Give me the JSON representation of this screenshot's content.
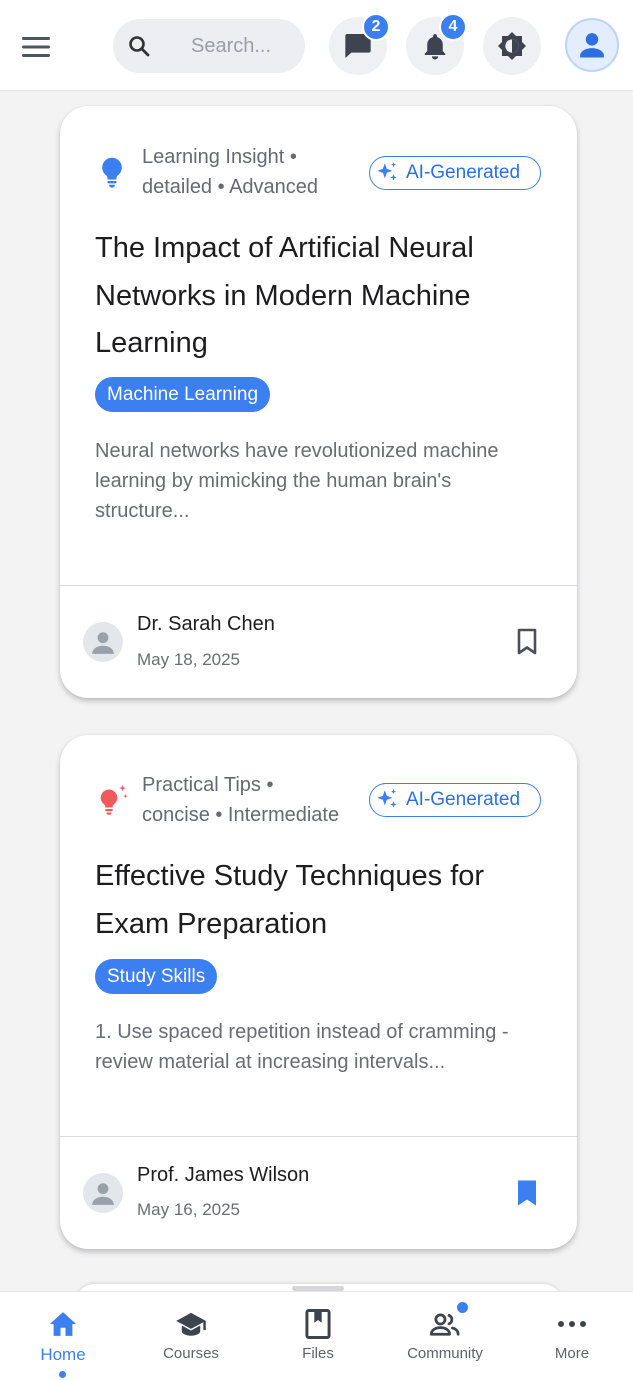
{
  "header": {
    "search_placeholder": "Search...",
    "messages_badge": "2",
    "notifications_badge": "4"
  },
  "posts": [
    {
      "meta_line1": "Learning Insight •",
      "meta_line2": "detailed • Advanced",
      "ai_label": "AI-Generated",
      "title": "The Impact of Artificial Neural Networks in Modern Machine Learning",
      "tag": "Machine Learning",
      "excerpt": "Neural networks have revolutionized machine learning by mimicking the human brain's structure...",
      "author": "Dr. Sarah Chen",
      "date": "May 18, 2025",
      "icon": "lightbulb-icon",
      "icon_color": "#3b7ff0",
      "bookmarked": false
    },
    {
      "meta_line1": "Practical Tips •",
      "meta_line2": "concise • Intermediate",
      "ai_label": "AI-Generated",
      "title": "Effective Study Techniques for Exam Preparation",
      "tag": "Study Skills",
      "excerpt": "1. Use spaced repetition instead of cramming - review material at increasing intervals...",
      "author": "Prof. James Wilson",
      "date": "May 16, 2025",
      "icon": "sparkle-bulb-icon",
      "icon_color": "#f05a5a",
      "bookmarked": true
    }
  ],
  "nav": {
    "items": [
      {
        "label": "Home",
        "icon": "home-icon",
        "active": true
      },
      {
        "label": "Courses",
        "icon": "graduation-cap-icon",
        "active": false
      },
      {
        "label": "Files",
        "icon": "book-icon",
        "active": false
      },
      {
        "label": "Community",
        "icon": "people-icon",
        "active": false,
        "has_dot": true
      },
      {
        "label": "More",
        "icon": "more-dots-icon",
        "active": false
      }
    ]
  },
  "colors": {
    "accent": "#3b7ff0",
    "background": "#f3f3f4"
  }
}
